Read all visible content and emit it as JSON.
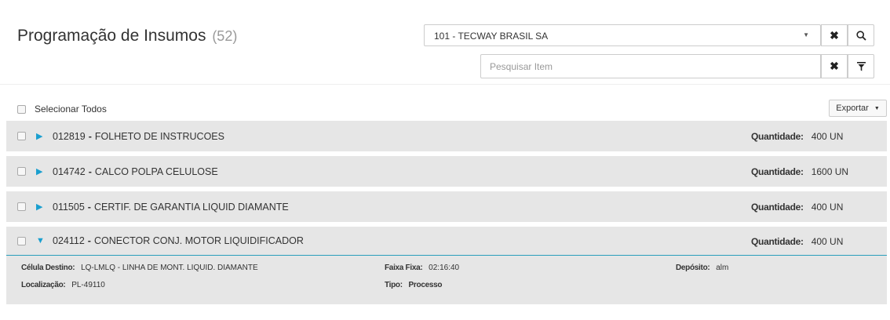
{
  "header": {
    "title": "Programação de Insumos",
    "count": "(52)",
    "company_select": "101 - TECWAY BRASIL SA",
    "search_placeholder": "Pesquisar Item"
  },
  "icons": {
    "clear": "close-icon",
    "search": "search-icon",
    "filter": "filter-icon",
    "dropdown": "caret-down-icon",
    "collapsed": "triangle-right-icon",
    "expanded": "triangle-down-icon"
  },
  "toolbar": {
    "select_all_label": "Selecionar Todos",
    "export_label": "Exportar"
  },
  "quantity_label": "Quantidade:",
  "items": [
    {
      "code": "012819",
      "separator": "-",
      "name": "FOLHETO DE INSTRUCOES",
      "quantity": "400 UN"
    },
    {
      "code": "014742",
      "separator": "-",
      "name": "CALCO POLPA CELULOSE",
      "quantity": "1600 UN"
    },
    {
      "code": "011505",
      "separator": "-",
      "name": "CERTIF. DE GARANTIA LIQUID DIAMANTE",
      "quantity": "400 UN"
    },
    {
      "code": "024112",
      "separator": "-",
      "name": "CONECTOR CONJ. MOTOR LIQUIDIFICADOR",
      "quantity": "400 UN"
    }
  ],
  "details": {
    "cell_label": "Célula Destino:",
    "cell_value": "LQ-LMLQ - LINHA DE MONT. LIQUID. DIAMANTE",
    "faixa_label": "Faixa Fixa:",
    "faixa_value": "02:16:40",
    "deposito_label": "Depósito:",
    "deposito_value": "alm",
    "localizacao_label": "Localização:",
    "localizacao_value": "PL-49110",
    "tipo_label": "Tipo:",
    "tipo_value": "Processo"
  },
  "colors": {
    "accent": "#1a9fcf",
    "row_background": "#e6e6e6",
    "expanded_border": "#2a9fbc"
  }
}
